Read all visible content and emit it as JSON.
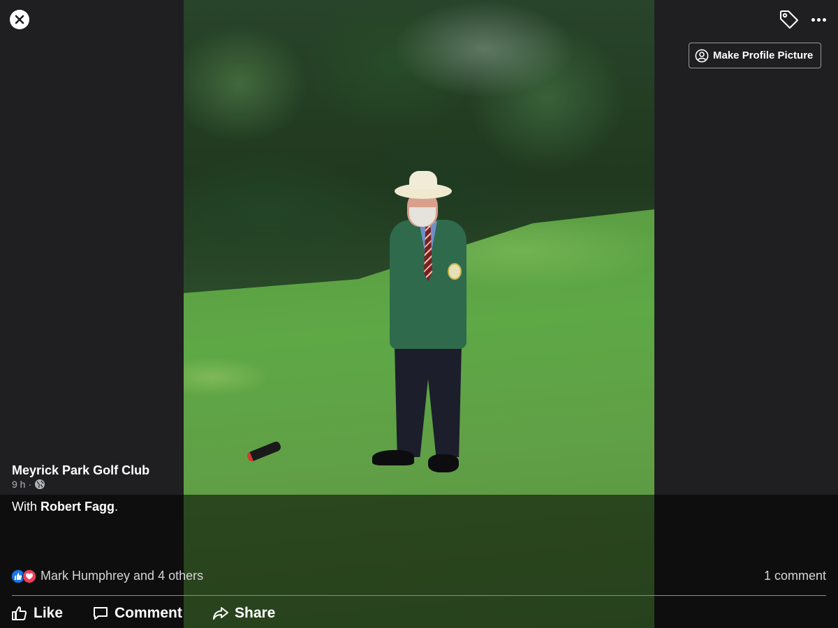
{
  "top_bar": {
    "close_icon": "close-icon",
    "tag_icon": "tag-icon",
    "more_icon": "more-icon",
    "profile_button_label": "Make Profile Picture",
    "profile_button_icon": "user-circle-icon"
  },
  "photo": {
    "alt_subject": "photo"
  },
  "post": {
    "page_name": "Meyrick Park Golf Club",
    "time": "9 h",
    "separator": "·",
    "privacy_icon": "globe-icon",
    "caption_prefix": "With ",
    "caption_person": "Robert Fagg",
    "caption_suffix": "."
  },
  "reactions": {
    "icons": [
      "like-reaction-icon",
      "love-reaction-icon"
    ],
    "text": "Mark Humphrey and 4 others",
    "comments": "1 comment"
  },
  "actions": {
    "like": "Like",
    "comment": "Comment",
    "share": "Share"
  },
  "colors": {
    "like_blue": "#1877f2",
    "love_red": "#f33e58",
    "background": "#1f1f21"
  }
}
